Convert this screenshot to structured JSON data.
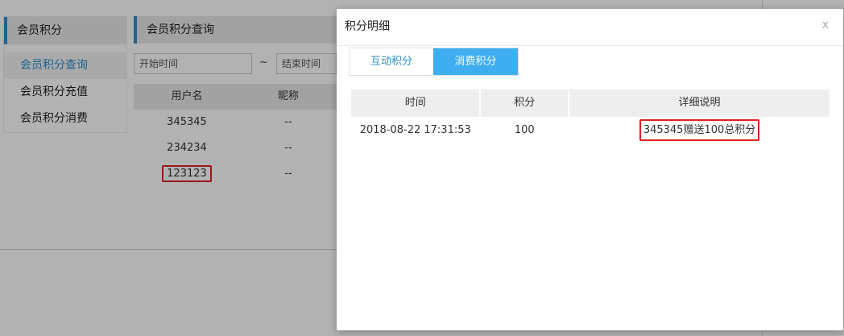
{
  "sidebar": {
    "title": "会员积分",
    "items": [
      {
        "label": "会员积分查询",
        "active": true
      },
      {
        "label": "会员积分充值",
        "active": false
      },
      {
        "label": "会员积分消费",
        "active": false
      }
    ]
  },
  "query": {
    "title": "会员积分查询",
    "start_placeholder": "开始时间",
    "end_placeholder": "结束时间",
    "separator": "~"
  },
  "user_table": {
    "headers": [
      "用户名",
      "昵称"
    ],
    "rows": [
      {
        "username": "345345",
        "nickname": "--"
      },
      {
        "username": "234234",
        "nickname": "--"
      },
      {
        "username": "123123",
        "nickname": "--"
      }
    ]
  },
  "modal": {
    "title": "积分明细",
    "close_label": "x",
    "tabs": [
      {
        "label": "互动积分",
        "active": false
      },
      {
        "label": "消费积分",
        "active": true
      }
    ],
    "headers": [
      "时间",
      "积分",
      "详细说明"
    ],
    "rows": [
      {
        "time": "2018-08-22 17:31:53",
        "points": "100",
        "detail": "345345赠送100总积分"
      }
    ]
  },
  "colors": {
    "accent": "#2b8fd0",
    "tab_active": "#3eaef0",
    "highlight": "#e02020"
  }
}
